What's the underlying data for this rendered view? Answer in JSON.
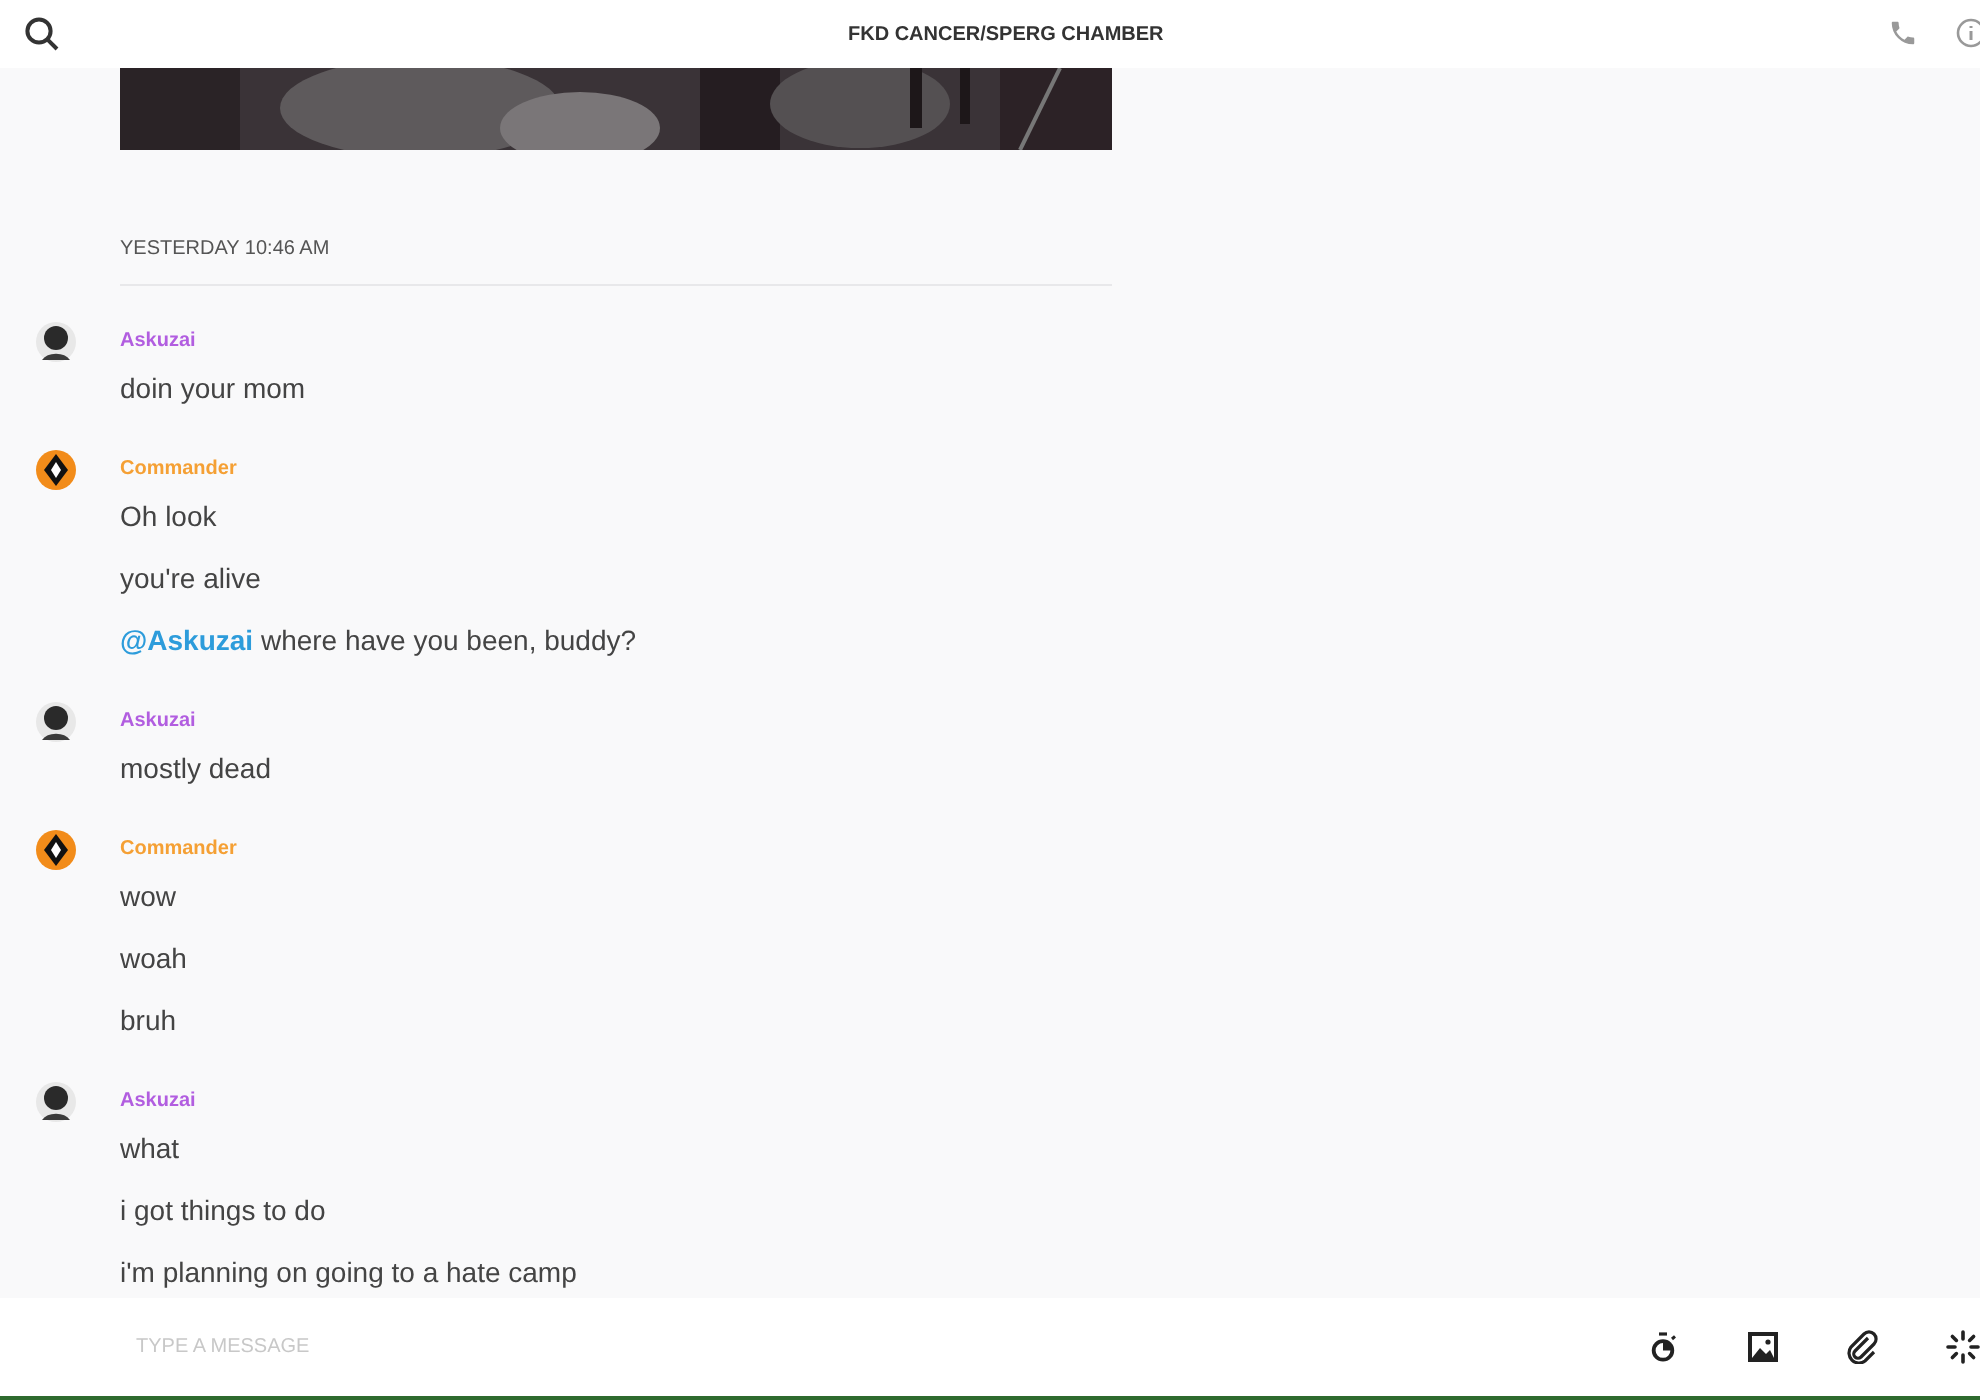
{
  "header": {
    "title": "FKD CANCER/SPERG CHAMBER"
  },
  "timestamp": "YESTERDAY 10:46 AM",
  "groups": [
    {
      "author": "Askuzai",
      "color": "#b25ee0",
      "lines": [
        "doin your mom"
      ]
    },
    {
      "author": "Commander",
      "color": "#f5a034",
      "kind": "diamond",
      "lines": [
        "Oh look",
        "you're alive",
        "**@Askuzai** where have you been, buddy?"
      ]
    },
    {
      "author": "Askuzai",
      "color": "#b25ee0",
      "lines": [
        "mostly dead"
      ]
    },
    {
      "author": "Commander",
      "color": "#f5a034",
      "kind": "diamond",
      "lines": [
        "wow",
        "woah",
        "bruh"
      ]
    },
    {
      "author": "Askuzai",
      "color": "#b25ee0",
      "lines": [
        "what",
        "i got things to do",
        "i'm planning on going to a hate camp"
      ]
    }
  ],
  "composer": {
    "placeholder": "TYPE A MESSAGE"
  }
}
